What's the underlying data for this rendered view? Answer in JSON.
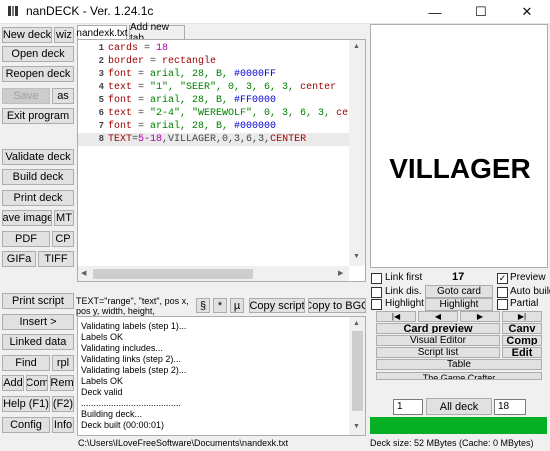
{
  "window": {
    "title": "nanDECK - Ver. 1.24.1c",
    "minimize_glyph": "—",
    "maximize_glyph": "☐",
    "close_glyph": "✕"
  },
  "sidebar": {
    "new_deck": "New deck",
    "wiz": "wiz",
    "open_deck": "Open deck",
    "reopen_deck": "Reopen deck",
    "save": "Save",
    "save_as": "as",
    "exit_program": "Exit program",
    "validate_deck": "Validate deck",
    "build_deck": "Build deck",
    "print_deck": "Print deck",
    "save_images": "Save images",
    "mt": "MT",
    "pdf": "PDF",
    "cp": "CP",
    "gifa": "GIFa",
    "tiff": "TIFF",
    "print_script": "Print script",
    "insert": "Insert >",
    "linked_data": "Linked data",
    "find": "Find",
    "rpl": "rpl",
    "add": "Add",
    "com": "Com",
    "rem": "Rem",
    "help": "Help (F1)",
    "f2": "(F2)",
    "config": "Config",
    "info": "Info"
  },
  "tabs": [
    "nandexk.txt",
    "Add new tab"
  ],
  "editor": {
    "lines": [
      {
        "n": "1",
        "tokens": [
          [
            "k",
            "cards"
          ],
          [
            "o",
            " = "
          ],
          [
            "n",
            "18"
          ]
        ]
      },
      {
        "n": "2",
        "tokens": [
          [
            "k",
            "border"
          ],
          [
            "o",
            " = "
          ],
          [
            "k",
            "rectangle"
          ]
        ]
      },
      {
        "n": "3",
        "tokens": [
          [
            "k",
            "font"
          ],
          [
            "o",
            " = "
          ],
          [
            "c",
            "arial, 28, B, "
          ],
          [
            "s",
            "#0000FF"
          ]
        ]
      },
      {
        "n": "4",
        "tokens": [
          [
            "k",
            "text"
          ],
          [
            "o",
            " = "
          ],
          [
            "c",
            "\"1\", \"SEER\", 0, 3, 6, 3, "
          ],
          [
            "k",
            "center"
          ]
        ]
      },
      {
        "n": "5",
        "tokens": [
          [
            "k",
            "font"
          ],
          [
            "o",
            " = "
          ],
          [
            "c",
            "arial, 28, B, "
          ],
          [
            "s",
            "#FF0000"
          ]
        ]
      },
      {
        "n": "6",
        "tokens": [
          [
            "k",
            "text"
          ],
          [
            "o",
            " = "
          ],
          [
            "c",
            "\"2-4\", \"WEREWOLF\", 0, 3, 6, 3, "
          ],
          [
            "k",
            "ce"
          ]
        ]
      },
      {
        "n": "7",
        "tokens": [
          [
            "k",
            "font"
          ],
          [
            "o",
            " = "
          ],
          [
            "c",
            "arial, 28, B, "
          ],
          [
            "s",
            "#000000"
          ]
        ]
      },
      {
        "n": "8",
        "tokens": [
          [
            "k",
            "TEXT"
          ],
          [
            "o",
            "="
          ],
          [
            "n",
            "5-18"
          ],
          [
            "o",
            ",VILLAGER,0,3,6,3,"
          ],
          [
            "k",
            "CENTER"
          ]
        ]
      }
    ]
  },
  "hint": {
    "text": "TEXT=\"range\", \"text\", pos x, pos y, width, height,",
    "section_btn": "§",
    "star_btn": "*",
    "mu_btn": "µ",
    "copy_script": "Copy script",
    "copy_to_bgg": "Copy to BGG"
  },
  "log": [
    "Validating labels (step 1)...",
    "Labels OK",
    "Validating includes...",
    "Validating links (step 2)...",
    "Validating labels (step 2)...",
    "Labels OK",
    "Deck valid",
    "........................................",
    "Building deck...",
    "Deck built (00:00:01)"
  ],
  "statusbar": {
    "path": "C:\\Users\\ILoveFreeSoftware\\Documents\\nandexk.txt",
    "deck_size": "Deck size: 52 MBytes (Cache: 0 MBytes)"
  },
  "preview": {
    "card_text": "VILLAGER",
    "link_first": "Link first",
    "card_number": "17",
    "preview_label": "Preview",
    "link_dis": "Link dis.",
    "goto_card": "Goto card",
    "auto_build": "Auto build",
    "highlight_chk": "Highlight",
    "highlight_btn": "Highlight",
    "partial": "Partial",
    "nav_first": "|◀",
    "nav_prev": "◀",
    "nav_next": "▶",
    "nav_last": "▶|",
    "card_preview": "Card preview",
    "canv": "Canv",
    "visual_editor": "Visual Editor",
    "comp": "Comp",
    "script_list": "Script list",
    "edit": "Edit",
    "table": "Table",
    "game_crafter": "The Game Crafter",
    "from_value": "1",
    "all_deck": "All deck",
    "to_value": "18",
    "preview_checked": "✓"
  },
  "colors": {
    "progress": "#06b025"
  }
}
